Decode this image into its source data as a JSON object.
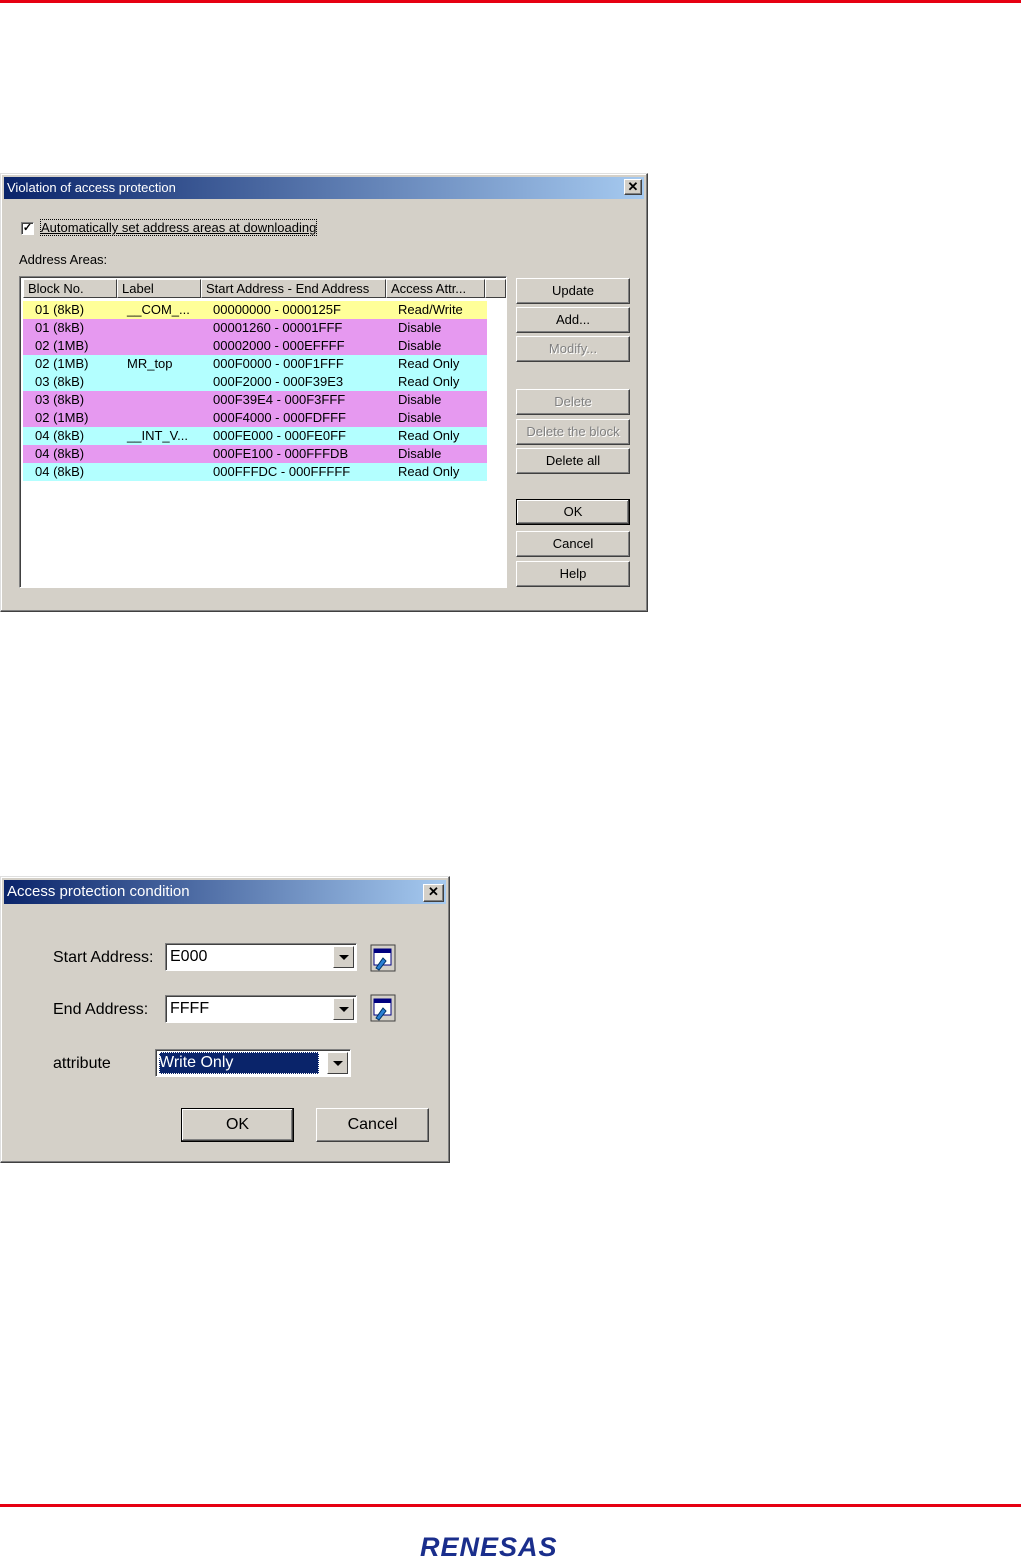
{
  "dialog1": {
    "title": "Violation of access protection",
    "auto_set_label": "Automatically set address areas at downloading",
    "auto_set_checked": true,
    "address_areas_label": "Address Areas:",
    "columns": [
      "Block No.",
      "Label",
      "Start Address - End Address",
      "Access Attr..."
    ],
    "rows": [
      {
        "block": "01 (8kB)",
        "label": "__COM_...",
        "range": "00000000 - 0000125F",
        "attr": "Read/Write",
        "color": "#ffff99"
      },
      {
        "block": "01 (8kB)",
        "label": "",
        "range": "00001260 - 00001FFF",
        "attr": "Disable",
        "color": "#e699f0"
      },
      {
        "block": "02 (1MB)",
        "label": "",
        "range": "00002000 - 000EFFFF",
        "attr": "Disable",
        "color": "#e699f0"
      },
      {
        "block": "02 (1MB)",
        "label": "MR_top",
        "range": "000F0000 - 000F1FFF",
        "attr": "Read Only",
        "color": "#b3ffff"
      },
      {
        "block": "03 (8kB)",
        "label": "",
        "range": "000F2000 - 000F39E3",
        "attr": "Read Only",
        "color": "#b3ffff"
      },
      {
        "block": "03 (8kB)",
        "label": "",
        "range": "000F39E4 - 000F3FFF",
        "attr": "Disable",
        "color": "#e699f0"
      },
      {
        "block": "02 (1MB)",
        "label": "",
        "range": "000F4000 - 000FDFFF",
        "attr": "Disable",
        "color": "#e699f0"
      },
      {
        "block": "04 (8kB)",
        "label": "__INT_V...",
        "range": "000FE000 - 000FE0FF",
        "attr": "Read Only",
        "color": "#b3ffff"
      },
      {
        "block": "04 (8kB)",
        "label": "",
        "range": "000FE100 - 000FFFDB",
        "attr": "Disable",
        "color": "#e699f0"
      },
      {
        "block": "04 (8kB)",
        "label": "",
        "range": "000FFFDC - 000FFFFF",
        "attr": "Read Only",
        "color": "#b3ffff"
      }
    ],
    "buttons": {
      "update": "Update",
      "add": "Add...",
      "modify": "Modify...",
      "delete": "Delete",
      "delete_block": "Delete the block",
      "delete_all": "Delete all",
      "ok": "OK",
      "cancel": "Cancel",
      "help": "Help"
    }
  },
  "dialog2": {
    "title": "Access protection condition",
    "start_label": "Start Address:",
    "start_value": "E000",
    "end_label": "End Address:",
    "end_value": "FFFF",
    "attr_label": "attribute",
    "attr_value": "Write Only",
    "ok": "OK",
    "cancel": "Cancel"
  },
  "footer": {
    "logo_text": "RENESAS",
    "accent_color": "#e60012"
  }
}
